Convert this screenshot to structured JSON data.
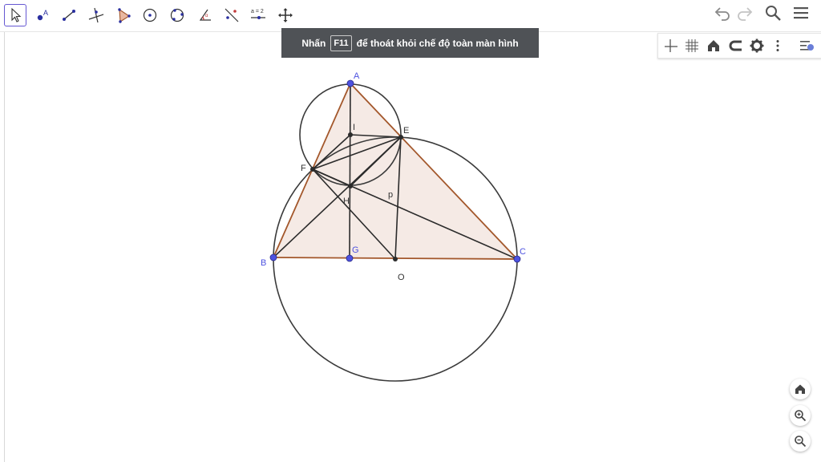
{
  "banner": {
    "pre": "Nhấn",
    "key": "F11",
    "post": "để thoát khỏi chế độ toàn màn hình"
  },
  "toolbar": {
    "tools": [
      "move-tool",
      "point-tool",
      "segment-tool",
      "perpendicular-line-tool",
      "polygon-tool",
      "circle-center-point-tool",
      "circle-three-points-tool",
      "angle-tool",
      "reflect-tool",
      "slider-tool",
      "move-graphics-view-tool"
    ],
    "slider_label": "a = 2",
    "right": [
      "undo-icon",
      "redo-icon",
      "search-icon",
      "menu-icon"
    ]
  },
  "graphics_view_bar": [
    "axes-toggle",
    "grid-toggle",
    "standard-view-home",
    "point-capturing",
    "settings",
    "more-options",
    "style-bar-toggle"
  ],
  "points": {
    "A": "A",
    "B": "B",
    "C": "C",
    "E": "E",
    "F": "F",
    "G": "G",
    "H": "H",
    "I": "I",
    "O": "O",
    "p": "p"
  },
  "colors": {
    "accent": "#6557d2",
    "point_blue": "#4d52e0",
    "triangle_stroke": "#a3572b",
    "triangle_fill": "#f2e3dc",
    "line": "#2b2b2b",
    "banner_bg": "#4f5256"
  },
  "zoom_controls": [
    "home-icon",
    "zoom-in-icon",
    "zoom-out-icon"
  ]
}
